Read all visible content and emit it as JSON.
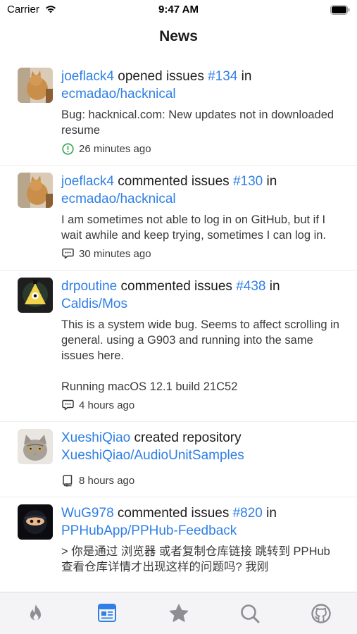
{
  "status_bar": {
    "carrier": "Carrier",
    "time": "9:47 AM"
  },
  "nav": {
    "title": "News"
  },
  "feed": [
    {
      "user": "joeflack4",
      "action": "opened issues",
      "issue": "#134",
      "preposition": "in",
      "repo": "ecmadao/hacknical",
      "body": "Bug: hacknical.com: New updates not in downloaded resume",
      "meta_icon": "issue-opened-icon",
      "time": "26 minutes ago"
    },
    {
      "user": "joeflack4",
      "action": "commented issues",
      "issue": "#130",
      "preposition": "in",
      "repo": "ecmadao/hacknical",
      "body": "I am sometimes not able to log in on GitHub, but if I wait awhile and keep trying, sometimes I can log in.",
      "meta_icon": "comment-icon",
      "time": "30 minutes ago"
    },
    {
      "user": "drpoutine",
      "action": "commented issues",
      "issue": "#438",
      "preposition": "in",
      "repo": "Caldis/Mos",
      "body": "This is a system wide bug. Seems to affect scrolling in general. using a G903 and running into the same issues here.\n\nRunning macOS 12.1 build 21C52",
      "meta_icon": "comment-icon",
      "time": "4 hours ago"
    },
    {
      "user": "XueshiQiao",
      "action": "created repository",
      "repo": "XueshiQiao/AudioUnitSamples",
      "meta_icon": "repo-icon",
      "time": "8 hours ago"
    },
    {
      "user": "WuG978",
      "action": "commented issues",
      "issue": "#820",
      "preposition": "in",
      "repo": "PPHubApp/PPHub-Feedback",
      "body": "> 你是通过 浏览器 或者复制仓库链接 跳转到 PPHub 查看仓库详情才出现这样的问题吗? 我刚",
      "meta_icon": "comment-icon",
      "time": ""
    }
  ],
  "tabs": [
    {
      "name": "trending-tab",
      "icon": "flame-icon",
      "active": false
    },
    {
      "name": "news-tab",
      "icon": "news-icon",
      "active": true
    },
    {
      "name": "starred-tab",
      "icon": "star-icon",
      "active": false
    },
    {
      "name": "search-tab",
      "icon": "search-icon",
      "active": false
    },
    {
      "name": "profile-tab",
      "icon": "github-icon",
      "active": false
    }
  ],
  "colors": {
    "link": "#2f7fe6",
    "active_tab": "#2f7fe6",
    "inactive_tab": "#8e8e93",
    "issue_green": "#2ea44f"
  }
}
